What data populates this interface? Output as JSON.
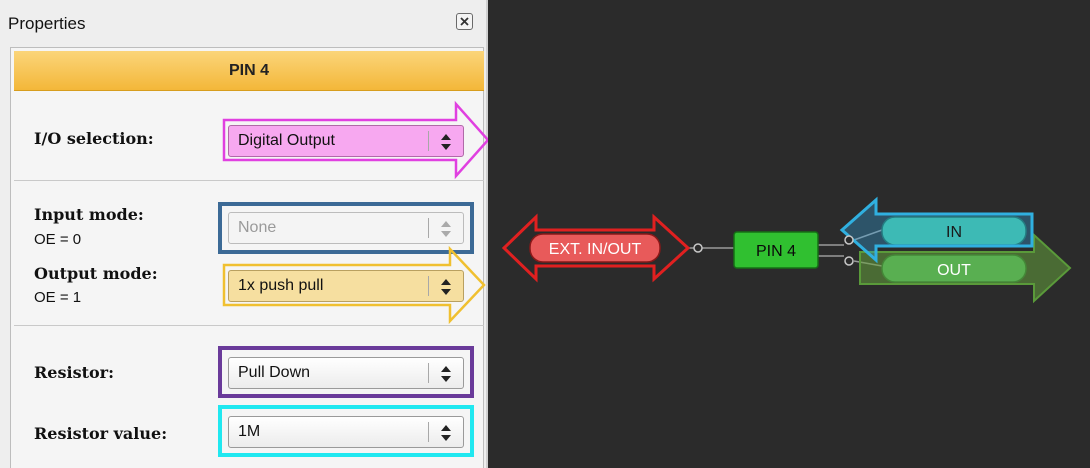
{
  "panel": {
    "title": "Properties",
    "close_icon": "close-icon",
    "header": "PIN 4"
  },
  "io": {
    "label": "I/O selection:",
    "value": "Digital Output"
  },
  "input_mode": {
    "label": "Input mode:",
    "sub": "OE = 0",
    "value": "None"
  },
  "output_mode": {
    "label": "Output mode:",
    "sub": "OE = 1",
    "value": "1x push pull"
  },
  "resistor": {
    "label": "Resistor:",
    "value": "Pull Down"
  },
  "resistor_value": {
    "label": "Resistor value:",
    "value": "1M"
  },
  "canvas": {
    "ext_label": "EXT. IN/OUT",
    "pin_label": "PIN 4",
    "in_label": "IN",
    "out_label": "OUT"
  },
  "colors": {
    "header_accent": "#f3b739",
    "highlight_pink": "#e040e0",
    "highlight_blue": "#3c6a96",
    "highlight_yellow": "#f0c030",
    "highlight_purple": "#6a3a9a",
    "highlight_cyan": "#20e8f0",
    "canvas_bg": "#2b2b2b",
    "ext_red": "#e02020",
    "pin_green": "#30c030",
    "in_cyan": "#30b0e0",
    "out_green": "#5a9a3a"
  }
}
